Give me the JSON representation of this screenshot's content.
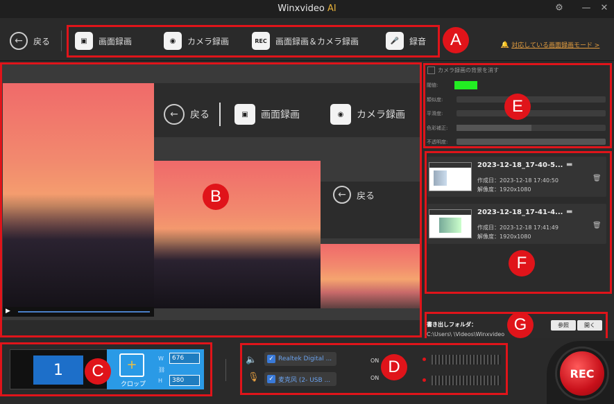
{
  "app": {
    "title": "Winxvideo",
    "title_ai": "AI"
  },
  "toolbar": {
    "back_label": "戻る",
    "screen_rec": "画面録画",
    "camera_rec": "カメラ録画",
    "screen_camera_rec": "画面録画＆カメラ録画",
    "audio_rec": "録音",
    "rec_icon_text": "REC",
    "supported_modes_link": "対応している画面録画モード >"
  },
  "badges": {
    "a": "A",
    "b": "B",
    "c": "C",
    "d": "D",
    "e": "E",
    "f": "F",
    "g": "G"
  },
  "preview": {
    "back_label": "戻る",
    "screen_rec": "画面録画",
    "camera_rec": "カメラ録画"
  },
  "camera_settings": {
    "remove_bg_label": "カメラ録画の背景を消す",
    "rows": [
      {
        "label": "閾値:",
        "level": 0.0
      },
      {
        "label": "類似度:",
        "level": 0.1
      },
      {
        "label": "平滑度:",
        "level": 0.1
      },
      {
        "label": "色彩補正:",
        "level": 0.5
      },
      {
        "label": "不透明度:",
        "level": 1.0
      }
    ],
    "key_color": "#22ee22"
  },
  "recordings": [
    {
      "name": "2023-12-18_17-40-5...",
      "created": "作成日：2023-12-18 17:40:50",
      "resolution": "解像度：1920x1080"
    },
    {
      "name": "2023-12-18_17-41-4...",
      "created": "作成日：2023-12-18 17:41:49",
      "resolution": "解像度：1920x1080"
    }
  ],
  "output": {
    "label": "書き出しフォルダ：",
    "path": "C:\\Users\\ \\Videos\\Winxvideo",
    "browse_button": "参照",
    "open_button": "開く"
  },
  "crop": {
    "screen_number": "1",
    "crop_label": "クロップ",
    "w_label": "W",
    "h_label": "H",
    "width": "676",
    "height": "380"
  },
  "audio": {
    "speaker_device": "Realtek Digital ...",
    "mic_device": "麦克风 (2- USB ...",
    "speaker_state": "ON",
    "mic_state": "ON"
  },
  "rec_button": "REC",
  "colors": {
    "accent_red": "#e0141a",
    "orange_link": "#e8a040",
    "blue": "#3a7ad8"
  }
}
